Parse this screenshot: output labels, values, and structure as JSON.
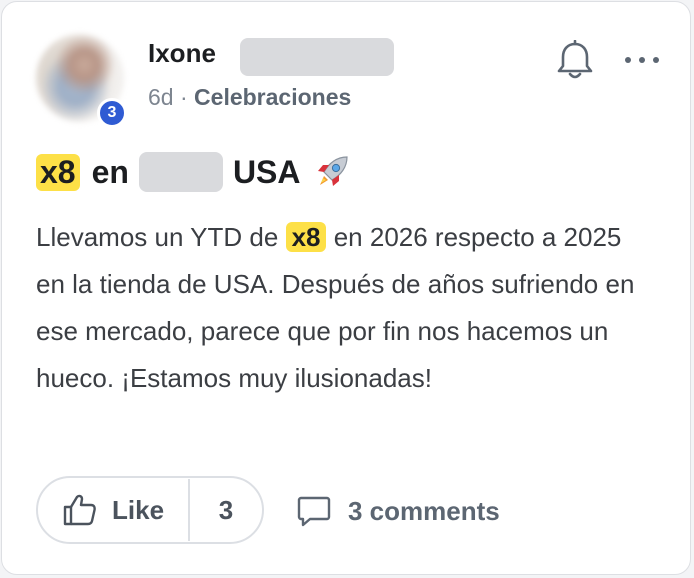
{
  "post": {
    "author": {
      "first_name": "Ixone",
      "avatar_badge": "3"
    },
    "meta": {
      "time": "6d",
      "separator": "·",
      "group": "Celebraciones"
    },
    "title": {
      "highlight": "x8",
      "word_before": "en",
      "word_after": "USA",
      "emoji": "rocket-icon"
    },
    "body": {
      "before": "Llevamos un YTD de",
      "highlight": "x8",
      "after": "en 2026 respecto a 2025 en la tienda de USA. Después de años sufriendo en ese mercado, parece que por fin nos hacemos un hueco. ¡Estamos muy ilusionadas!"
    },
    "reactions": {
      "like_label": "Like",
      "like_count": "3",
      "comments_label": "3 comments"
    },
    "icons": {
      "notifications": "bell-icon",
      "menu": "more-dots-icon",
      "like": "thumbs-up-icon",
      "comments": "comment-bubble-icon"
    },
    "colors": {
      "highlight": "#fde047",
      "badge": "#2f5bd3",
      "redaction": "#d9dadd"
    }
  }
}
